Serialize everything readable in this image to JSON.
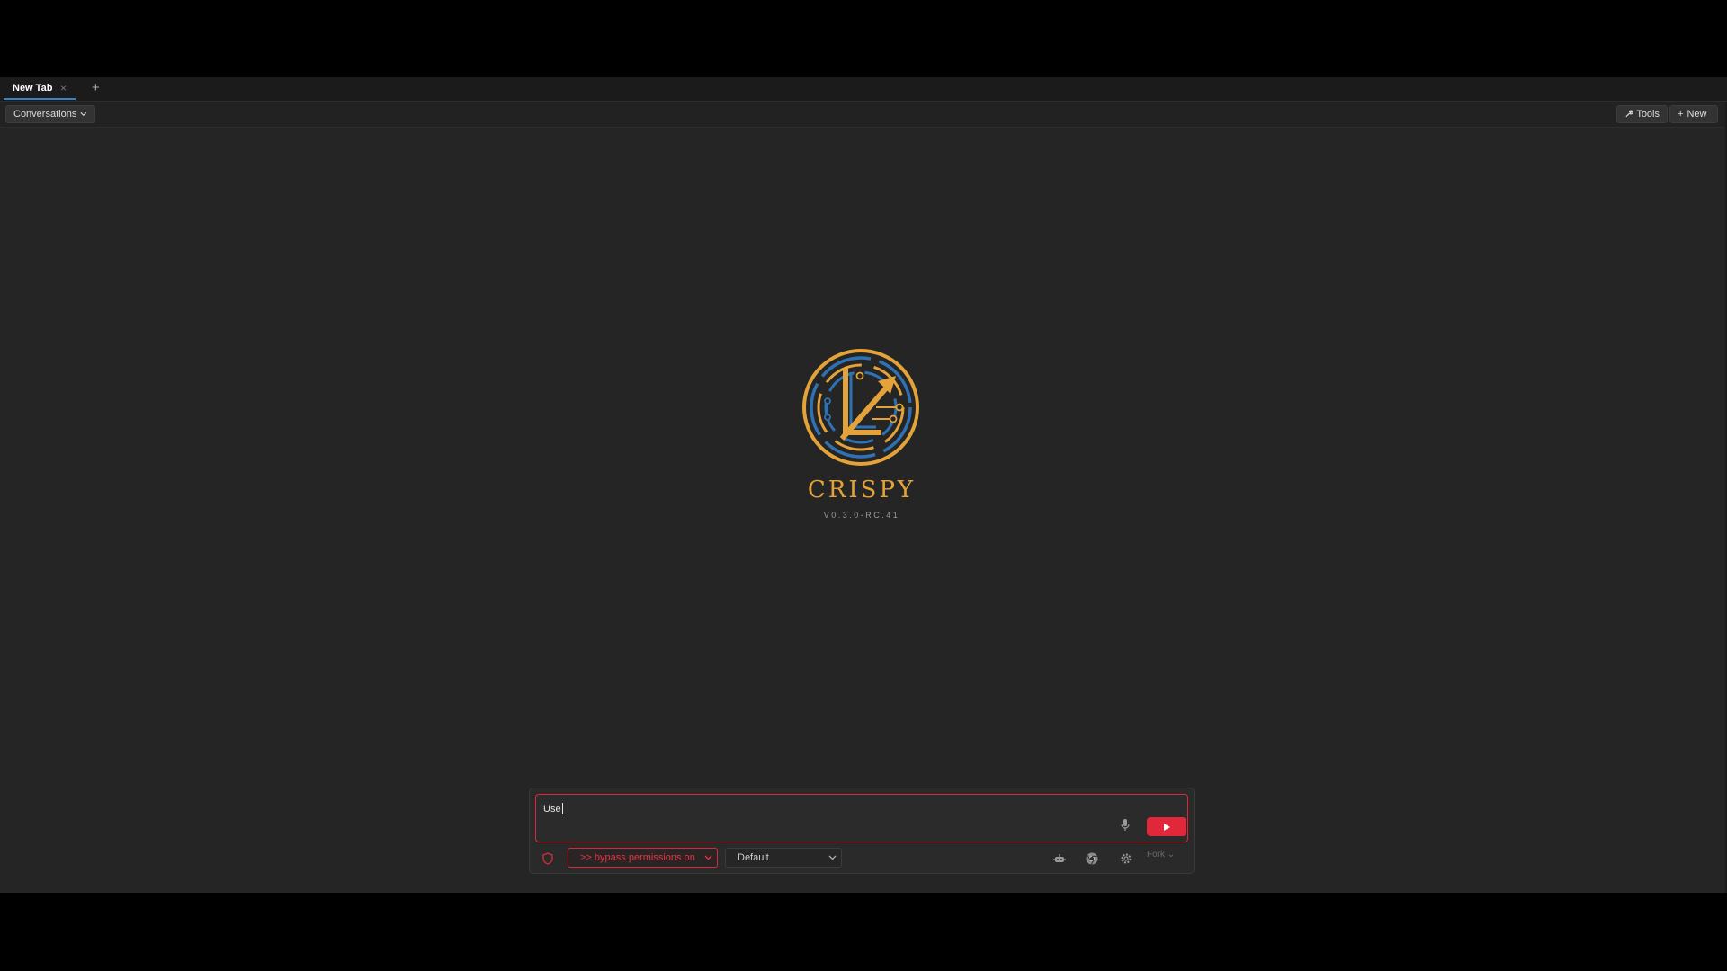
{
  "tabbar": {
    "tabs": [
      {
        "label": "New Tab",
        "active": true
      }
    ],
    "add_icon": "plus-icon"
  },
  "toolbar": {
    "conversations_label": "Conversations",
    "tools_label": "Tools",
    "new_label": "New"
  },
  "splash": {
    "brand": "CRISPY",
    "version": "V0.3.0-RC.41",
    "colors": {
      "gold": "#e3a33a",
      "blue": "#2f72b4"
    }
  },
  "composer": {
    "input_value": "Use",
    "permission_mode": "bypass permissions on",
    "permission_prefix": ">>",
    "model": "Default",
    "fork_label": "Fork",
    "accent": "#e0283a",
    "icons": [
      "microphone-icon",
      "send-icon",
      "shield-icon",
      "robot-icon",
      "chrome-icon",
      "gear-icon"
    ]
  }
}
